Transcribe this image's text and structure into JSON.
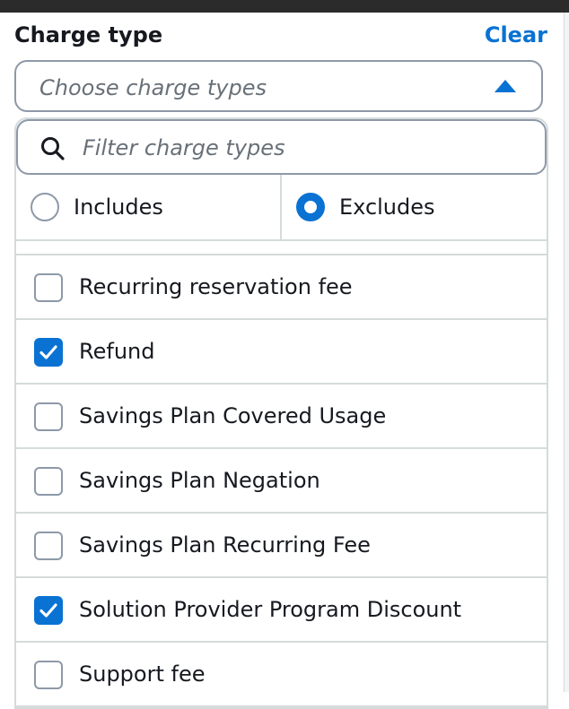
{
  "filter_group": {
    "title": "Charge type",
    "clear_label": "Clear",
    "select_placeholder": "Choose charge types"
  },
  "dropdown": {
    "filter_placeholder": "Filter charge types",
    "modes": [
      {
        "label": "Includes",
        "selected": false
      },
      {
        "label": "Excludes",
        "selected": true
      }
    ],
    "options": [
      {
        "label": "Recurring reservation fee",
        "checked": false
      },
      {
        "label": "Refund",
        "checked": true
      },
      {
        "label": "Savings Plan Covered Usage",
        "checked": false
      },
      {
        "label": "Savings Plan Negation",
        "checked": false
      },
      {
        "label": "Savings Plan Recurring Fee",
        "checked": false
      },
      {
        "label": "Solution Provider Program Discount",
        "checked": true
      },
      {
        "label": "Support fee",
        "checked": false
      }
    ]
  },
  "colors": {
    "accent": "#0972d3",
    "border": "#d5dbdb",
    "text": "#16191f",
    "placeholder": "#687078"
  },
  "icons": {
    "filter": "search-icon",
    "select": "caret-up-icon",
    "checked": "check-icon"
  }
}
